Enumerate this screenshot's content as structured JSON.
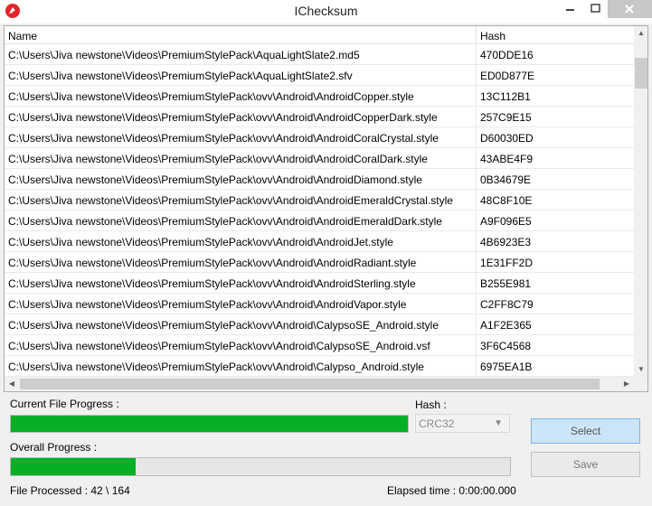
{
  "window": {
    "title": "IChecksum"
  },
  "list": {
    "columns": [
      "Name",
      "Hash"
    ],
    "rows": [
      {
        "name": "C:\\Users\\Jiva newstone\\Videos\\PremiumStylePack\\AquaLightSlate2.md5",
        "hash": "470DDE16"
      },
      {
        "name": "C:\\Users\\Jiva newstone\\Videos\\PremiumStylePack\\AquaLightSlate2.sfv",
        "hash": "ED0D877E"
      },
      {
        "name": "C:\\Users\\Jiva newstone\\Videos\\PremiumStylePack\\ovv\\Android\\AndroidCopper.style",
        "hash": "13C112B1"
      },
      {
        "name": "C:\\Users\\Jiva newstone\\Videos\\PremiumStylePack\\ovv\\Android\\AndroidCopperDark.style",
        "hash": "257C9E15"
      },
      {
        "name": "C:\\Users\\Jiva newstone\\Videos\\PremiumStylePack\\ovv\\Android\\AndroidCoralCrystal.style",
        "hash": "D60030ED"
      },
      {
        "name": "C:\\Users\\Jiva newstone\\Videos\\PremiumStylePack\\ovv\\Android\\AndroidCoralDark.style",
        "hash": "43ABE4F9"
      },
      {
        "name": "C:\\Users\\Jiva newstone\\Videos\\PremiumStylePack\\ovv\\Android\\AndroidDiamond.style",
        "hash": "0B34679E"
      },
      {
        "name": "C:\\Users\\Jiva newstone\\Videos\\PremiumStylePack\\ovv\\Android\\AndroidEmeraldCrystal.style",
        "hash": "48C8F10E"
      },
      {
        "name": "C:\\Users\\Jiva newstone\\Videos\\PremiumStylePack\\ovv\\Android\\AndroidEmeraldDark.style",
        "hash": "A9F096E5"
      },
      {
        "name": "C:\\Users\\Jiva newstone\\Videos\\PremiumStylePack\\ovv\\Android\\AndroidJet.style",
        "hash": "4B6923E3"
      },
      {
        "name": "C:\\Users\\Jiva newstone\\Videos\\PremiumStylePack\\ovv\\Android\\AndroidRadiant.style",
        "hash": "1E31FF2D"
      },
      {
        "name": "C:\\Users\\Jiva newstone\\Videos\\PremiumStylePack\\ovv\\Android\\AndroidSterling.style",
        "hash": "B255E981"
      },
      {
        "name": "C:\\Users\\Jiva newstone\\Videos\\PremiumStylePack\\ovv\\Android\\AndroidVapor.style",
        "hash": "C2FF8C79"
      },
      {
        "name": "C:\\Users\\Jiva newstone\\Videos\\PremiumStylePack\\ovv\\Android\\CalypsoSE_Android.style",
        "hash": "A1F2E365"
      },
      {
        "name": "C:\\Users\\Jiva newstone\\Videos\\PremiumStylePack\\ovv\\Android\\CalypsoSE_Android.vsf",
        "hash": "3F6C4568"
      },
      {
        "name": "C:\\Users\\Jiva newstone\\Videos\\PremiumStylePack\\ovv\\Android\\Calypso_Android.style",
        "hash": "6975EA1B"
      }
    ]
  },
  "progress": {
    "current_label": "Current File Progress :",
    "current_fraction": 1.0,
    "overall_label": "Overall Progress :",
    "overall_fraction": 0.25,
    "fill_color": "#06b025"
  },
  "hash_selector": {
    "label": "Hash :",
    "selected": "CRC32"
  },
  "buttons": {
    "select": "Select",
    "save": "Save"
  },
  "status": {
    "files_processed": "File Processed : 42 \\ 164",
    "elapsed": "Elapsed time : 0:00:00.000"
  },
  "icons": {
    "app": "app-logo-icon",
    "minimize": "minimize-icon",
    "maximize": "maximize-icon",
    "close": "close-icon"
  }
}
